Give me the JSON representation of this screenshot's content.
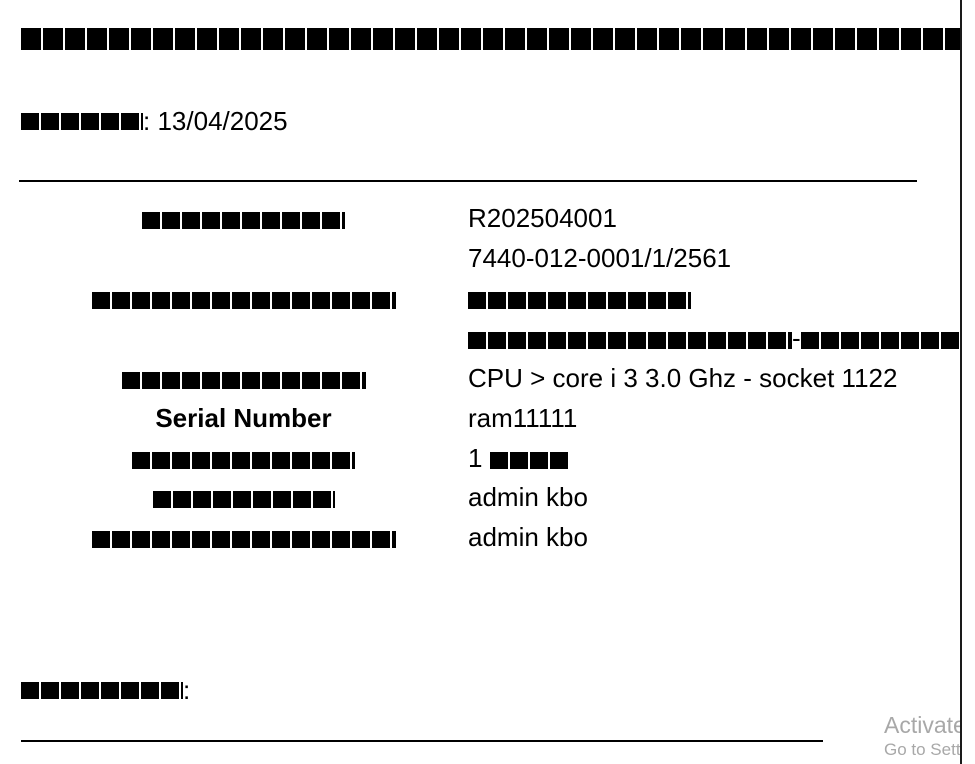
{
  "header": {
    "title": "",
    "date_label": "",
    "date_sep": ":",
    "date_value": "13/04/2025"
  },
  "fields": [
    {
      "label": "",
      "value": "R202504001"
    },
    {
      "label": "",
      "value": "7440-012-0001/1/2561"
    },
    {
      "label": "",
      "value": ""
    },
    {
      "label": "",
      "value": "-"
    },
    {
      "label": "",
      "value": "CPU > core i 3 3.0 Ghz - socket 1122"
    },
    {
      "label": "Serial Number",
      "value": "ram11111"
    },
    {
      "label": "",
      "value": "1"
    },
    {
      "label": "",
      "value": "admin kbo"
    },
    {
      "label": "",
      "value": "admin kbo"
    }
  ],
  "signature": {
    "label": "",
    "label_sep": ":"
  },
  "watermark": {
    "line1": "Activate",
    "line2": "Go to Setti"
  }
}
